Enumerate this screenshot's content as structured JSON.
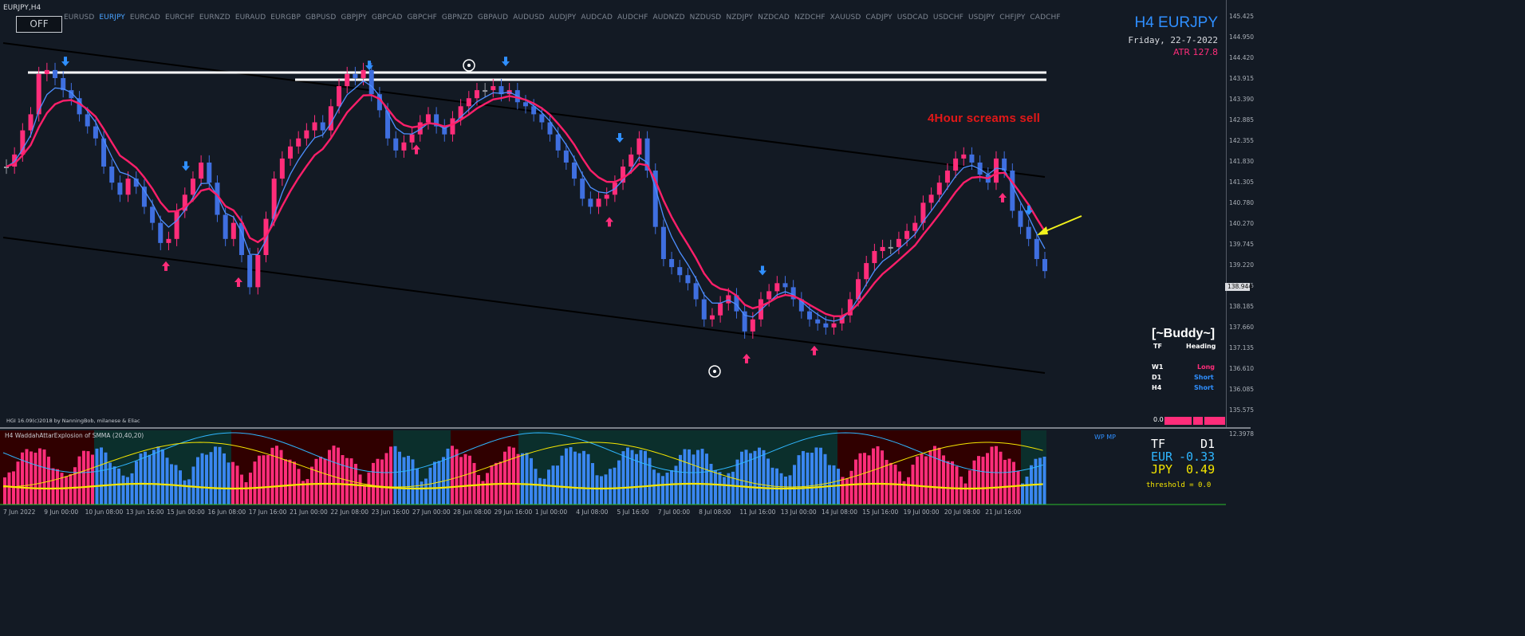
{
  "window": {
    "symbol_period": "EURJPY,H4",
    "off_button": "OFF"
  },
  "symbol_bar": [
    "EURUSD",
    "EURJPY",
    "EURCAD",
    "EURCHF",
    "EURNZD",
    "EURAUD",
    "EURGBP",
    "GBPUSD",
    "GBPJPY",
    "GBPCAD",
    "GBPCHF",
    "GBPNZD",
    "GBPAUD",
    "AUDUSD",
    "AUDJPY",
    "AUDCAD",
    "AUDCHF",
    "AUDNZD",
    "NZDUSD",
    "NZDJPY",
    "NZDCAD",
    "NZDCHF",
    "XAUUSD",
    "CADJPY",
    "USDCAD",
    "USDCHF",
    "USDJPY",
    "CHFJPY",
    "CADCHF"
  ],
  "active_symbol": "EURJPY",
  "info_box": {
    "title": "H4 EURJPY",
    "date": "Friday, 22-7-2022",
    "atr": "ATR 127.8"
  },
  "annotation": "4Hour screams sell",
  "buddy": {
    "title": "[~Buddy~]",
    "tf_header": "TF",
    "heading_header": "Heading",
    "rows": [
      {
        "tf": "W1",
        "heading": "Long",
        "color": "#ff2d7a"
      },
      {
        "tf": "D1",
        "heading": "Short",
        "color": "#2f8fff"
      },
      {
        "tf": "H4",
        "heading": "Short",
        "color": "#2f8fff"
      }
    ]
  },
  "copyright": "HGI 16.09(c)2018 by NanningBob, milanese & Eliac",
  "zero_label": "0.0",
  "price_axis": [
    "145.425",
    "144.950",
    "144.420",
    "143.915",
    "143.390",
    "142.885",
    "142.355",
    "141.830",
    "141.305",
    "140.780",
    "140.270",
    "139.745",
    "139.220",
    "138.695",
    "138.185",
    "137.660",
    "137.135",
    "136.610",
    "136.085",
    "135.575"
  ],
  "current_price": "138.944",
  "colors": {
    "background": "#131a24",
    "bull_candle": "#ff2d7a",
    "bear_candle": "#3f6fe0",
    "neutral_candle": "#9a9ea6",
    "fast_ma": "#4d8fff",
    "slow_ma": "#ff1f6a",
    "arrow_up": "#ff2d7a",
    "arrow_down": "#2f8fff",
    "annotation_arrow": "#f2f21c"
  },
  "sub_window": {
    "title": "H4 WaddahAttarExplosion of SMMA (20,40,20)",
    "axis_max": "12.3978",
    "wpmp": "WP MP",
    "tf_label": "TF",
    "tf_value": "D1",
    "rows": [
      {
        "currency": "EUR",
        "value": "-0.33",
        "color": "#2fb6ff"
      },
      {
        "currency": "JPY",
        "value": "0.49",
        "color": "#f5e600"
      }
    ],
    "threshold": "threshold = 0.0"
  },
  "time_axis": [
    "7 Jun 2022",
    "9 Jun 00:00",
    "10 Jun 08:00",
    "13 Jun 16:00",
    "15 Jun 00:00",
    "16 Jun 08:00",
    "17 Jun 16:00",
    "21 Jun 00:00",
    "22 Jun 08:00",
    "23 Jun 16:00",
    "27 Jun 00:00",
    "28 Jun 08:00",
    "29 Jun 16:00",
    "1 Jul 00:00",
    "4 Jul 08:00",
    "5 Jul 16:00",
    "7 Jul 00:00",
    "8 Jul 08:00",
    "11 Jul 16:00",
    "13 Jul 00:00",
    "14 Jul 08:00",
    "15 Jul 16:00",
    "19 Jul 00:00",
    "20 Jul 08:00",
    "21 Jul 16:00"
  ],
  "price_series": {
    "close": [
      141.6,
      141.9,
      142.5,
      142.9,
      143.9,
      144.0,
      143.8,
      143.5,
      143.3,
      142.9,
      142.6,
      142.3,
      141.6,
      141.2,
      140.9,
      141.3,
      141.1,
      140.6,
      140.2,
      139.7,
      139.8,
      140.5,
      140.9,
      141.3,
      141.7,
      141.2,
      140.4,
      139.8,
      140.2,
      139.4,
      138.6,
      139.4,
      140.3,
      141.3,
      141.8,
      142.1,
      142.3,
      142.5,
      142.7,
      142.5,
      143.1,
      143.6,
      143.9,
      143.8,
      144.0,
      143.4,
      143.0,
      142.3,
      142.0,
      142.2,
      142.4,
      142.7,
      142.9,
      142.6,
      142.4,
      142.8,
      143.1,
      143.3,
      143.5,
      143.5,
      143.6,
      143.4,
      143.5,
      143.2,
      143.1,
      142.9,
      142.7,
      142.4,
      142.0,
      141.7,
      141.3,
      140.8,
      140.6,
      140.8,
      140.9,
      141.2,
      141.6,
      141.9,
      142.3,
      141.5,
      140.1,
      139.3,
      139.1,
      138.9,
      138.7,
      138.3,
      137.8,
      137.9,
      138.2,
      138.4,
      138.0,
      137.5,
      137.8,
      138.3,
      138.5,
      138.7,
      138.6,
      138.3,
      138.0,
      137.8,
      137.7,
      137.6,
      137.7,
      137.9,
      138.3,
      138.8,
      139.2,
      139.5,
      139.6,
      139.6,
      139.8,
      140.0,
      140.2,
      140.7,
      140.9,
      141.2,
      141.5,
      141.8,
      141.9,
      141.7,
      141.4,
      141.2,
      141.8,
      141.5,
      140.5,
      140.1,
      139.8,
      139.3,
      139.0
    ]
  }
}
